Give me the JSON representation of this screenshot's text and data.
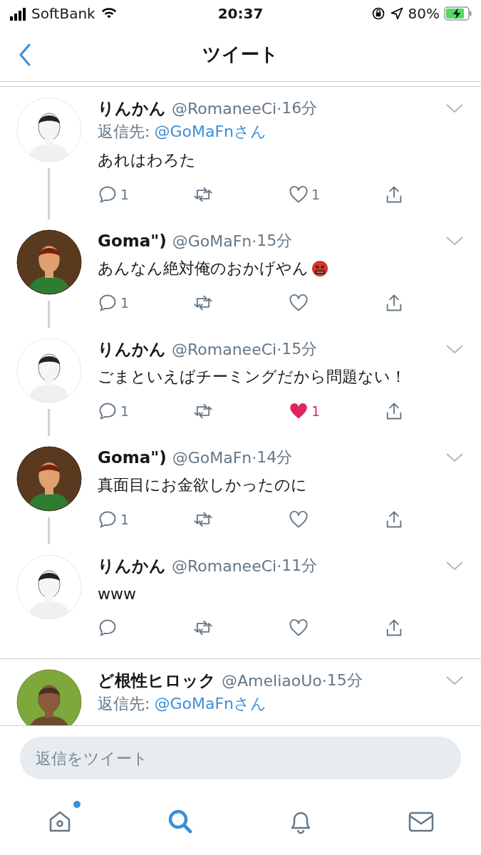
{
  "status_bar": {
    "carrier": "SoftBank",
    "time": "20:37",
    "battery": "80%"
  },
  "nav": {
    "title": "ツイート"
  },
  "tweets": [
    {
      "kind": "sketch",
      "name": "りんかん",
      "handle": "@RomaneeCi",
      "dot": "·",
      "time": "16分",
      "reply_prefix": "返信先:",
      "reply_to": "@GoMaFnさん",
      "text": "あれはわろた",
      "reply_count": "1",
      "like_count": "1",
      "liked": false,
      "thread_next": true
    },
    {
      "kind": "anime",
      "name": "Goma\")",
      "handle": "@GoMaFn",
      "dot": "·",
      "time": "15分",
      "text": "あんなん絶対俺のおかげやん",
      "emoji": true,
      "reply_count": "1",
      "liked": false,
      "thread_next": true
    },
    {
      "kind": "sketch",
      "name": "りんかん",
      "handle": "@RomaneeCi",
      "dot": "·",
      "time": "15分",
      "text": "ごまといえばチーミングだから問題ない！",
      "reply_count": "1",
      "like_count": "1",
      "liked": true,
      "thread_next": true
    },
    {
      "kind": "anime",
      "name": "Goma\")",
      "handle": "@GoMaFn",
      "dot": "·",
      "time": "14分",
      "text": "真面目にお金欲しかったのに",
      "reply_count": "1",
      "liked": false,
      "thread_next": true
    },
    {
      "kind": "sketch",
      "name": "りんかん",
      "handle": "@RomaneeCi",
      "dot": "·",
      "time": "11分",
      "text": "www",
      "liked": false,
      "thread_next": false
    },
    {
      "kind": "game",
      "name": "ど根性ヒロック",
      "handle": "@AmeliaoUo",
      "dot": "·",
      "time": "15分",
      "reply_prefix": "返信先:",
      "reply_to": "@GoMaFnさん",
      "separated": true
    }
  ],
  "reply_box": {
    "placeholder": "返信をツイート"
  },
  "tab_bar": [
    {
      "kind": "home",
      "selected": false,
      "badge": true
    },
    {
      "kind": "search",
      "selected": true,
      "badge": false
    },
    {
      "kind": "notifications",
      "selected": false,
      "badge": false
    },
    {
      "kind": "messages",
      "selected": false,
      "badge": false
    }
  ]
}
